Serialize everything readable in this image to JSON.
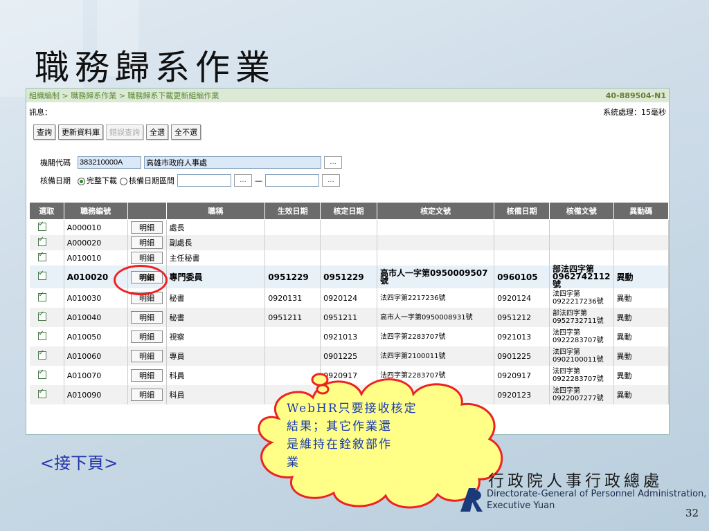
{
  "slide": {
    "title": "職務歸系作業",
    "next_page": "<接下頁>",
    "page_number": "32"
  },
  "app": {
    "breadcrumb": "組織編制 > 職務歸系作業 > 職務歸系下載更新組編作業",
    "code": "40-889504-N1",
    "message_label": "訊息：",
    "system_processing": "系統處理：15毫秒",
    "buttons": {
      "query": "查詢",
      "update_db": "更新資料庫",
      "error_query": "錯誤查詢",
      "select_all": "全選",
      "select_none": "全不選"
    },
    "form": {
      "org_code_label": "機關代碼",
      "org_code_value": "383210000A",
      "org_name_value": "高雄市政府人事處",
      "dots": "...",
      "approve_date_label": "核備日期",
      "opt_full_download": "完整下載",
      "opt_date_range": "核備日期區間",
      "dash": "—"
    },
    "table": {
      "headers": [
        "選取",
        "職務編號",
        "",
        "職稱",
        "生效日期",
        "核定日期",
        "核定文號",
        "核備日期",
        "核備文號",
        "異動碼"
      ],
      "detail_label": "明細",
      "rows": [
        {
          "id": "A000010",
          "title": "處長",
          "eff": "",
          "appr": "",
          "appr_no": "",
          "rec": "",
          "rec_no": "",
          "chg": ""
        },
        {
          "id": "A000020",
          "title": "副處長",
          "eff": "",
          "appr": "",
          "appr_no": "",
          "rec": "",
          "rec_no": "",
          "chg": ""
        },
        {
          "id": "A010010",
          "title": "主任秘書",
          "eff": "",
          "appr": "",
          "appr_no": "",
          "rec": "",
          "rec_no": "",
          "chg": ""
        },
        {
          "id": "A010020",
          "title": "專門委員",
          "eff": "0951229",
          "appr": "0951229",
          "appr_no": "高市人一字第0950009507號",
          "rec": "0960105",
          "rec_no": "部法四字第0962742112號",
          "chg": "異動"
        },
        {
          "id": "A010030",
          "title": "秘書",
          "eff": "0920131",
          "appr": "0920124",
          "appr_no": "法四字第2217236號",
          "rec": "0920124",
          "rec_no": "法四字第0922217236號",
          "chg": "異動"
        },
        {
          "id": "A010040",
          "title": "秘書",
          "eff": "0951211",
          "appr": "0951211",
          "appr_no": "高市人一字第0950008931號",
          "rec": "0951212",
          "rec_no": "部法四字第0952732711號",
          "chg": "異動"
        },
        {
          "id": "A010050",
          "title": "視察",
          "eff": "",
          "appr": "0921013",
          "appr_no": "法四字第2283707號",
          "rec": "0921013",
          "rec_no": "法四字第0922283707號",
          "chg": "異動"
        },
        {
          "id": "A010060",
          "title": "專員",
          "eff": "",
          "appr": "0901225",
          "appr_no": "法四字第2100011號",
          "rec": "0901225",
          "rec_no": "法四字第0902100011號",
          "chg": "異動"
        },
        {
          "id": "A010070",
          "title": "科員",
          "eff": "",
          "appr": "0920917",
          "appr_no": "法四字第2283707號",
          "rec": "0920917",
          "rec_no": "法四字第0922283707號",
          "chg": "異動"
        },
        {
          "id": "A010090",
          "title": "科員",
          "eff": "",
          "appr": "",
          "appr_no": "",
          "rec": "0920123",
          "rec_no": "法四字第0922007277號",
          "chg": "異動"
        }
      ]
    }
  },
  "callout": {
    "text_lines": [
      "WebHR只要接收核定",
      "結果；其它作業還",
      "是維持在銓敘部作",
      "業"
    ]
  },
  "logo": {
    "cn": "行政院人事行政總處",
    "en_line1": "Directorate-General of Personnel Administration,",
    "en_line2": "Executive Yuan"
  },
  "colors": {
    "accent_red": "#e22222",
    "header_gray": "#6b6b6b",
    "callout_fill": "#ffff88",
    "callout_text": "#1a3ab0"
  }
}
